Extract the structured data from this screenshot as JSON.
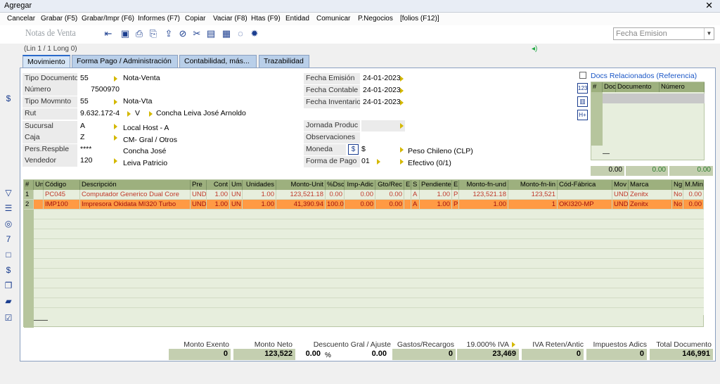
{
  "window": {
    "title": "Agregar",
    "close": "✕"
  },
  "menu": [
    "Cancelar",
    "Grabar (F5)",
    "Grabar/Impr (F6)",
    "Informes (F7)",
    "Copiar",
    "Vaciar (F8)",
    "Htas (F9)",
    "Entidad",
    "Comunicar",
    "P.Negocios",
    "[folios (F12)]"
  ],
  "toolbar": {
    "logo": "Notas de Venta",
    "sort_combo": "Fecha Emision"
  },
  "status": "(Lin 1 / 1 Long 0)",
  "tabs": [
    "Movimiento",
    "Forma Pago / Administración",
    "Contabilidad, más...",
    "Trazabilidad"
  ],
  "form": {
    "tipo_doc_label": "Tipo Documento",
    "tipo_doc": "55",
    "tipo_doc_desc": "Nota-Venta",
    "numero_label": "Número",
    "numero": "7500970",
    "tipo_mov_label": "Tipo Movmnto",
    "tipo_mov": "55",
    "tipo_mov_desc": "Nota-Vta",
    "rut_label": "Rut",
    "rut": "9.632.172-4",
    "rut_dv": "V",
    "rut_name": "Concha Leiva José Arnoldo",
    "sucursal_label": "Sucursal",
    "sucursal": "A",
    "sucursal_desc": "Local Host - A",
    "caja_label": "Caja",
    "caja": "Z",
    "caja_desc": "CM- Gral / Otros",
    "pers_label": "Pers.Respble",
    "pers": "****",
    "pers_desc": "Concha José",
    "vend_label": "Vendedor",
    "vend": "120",
    "vend_desc": "Leiva Patricio",
    "f_emision_label": "Fecha Emisión",
    "f_emision": "24-01-2023",
    "f_contable_label": "Fecha Contable",
    "f_contable": "24-01-2023",
    "f_inventario_label": "Fecha Inventario",
    "f_inventario": "24-01-2023",
    "jornada_label": "Jornada Produc",
    "obs_label": "Observaciones",
    "moneda_label": "Moneda",
    "moneda": "$",
    "moneda_desc": "Peso Chileno (CLP)",
    "forma_pago_label": "Forma de Pago",
    "forma_pago": "01",
    "forma_pago_desc": "Efectivo (0/1)"
  },
  "docs": {
    "label": "Docs Relacionados (Referencia)",
    "headers": [
      "#",
      "Doc",
      "Documento",
      "Número"
    ],
    "dash": "—",
    "sums": [
      "0.00",
      "0.00",
      "0.00"
    ]
  },
  "grid": {
    "headers": [
      "#",
      "Un",
      "Código",
      "Descripción",
      "Pre",
      "Cont",
      "Um",
      "Unidades",
      "Monto-Unit",
      "%Dsc",
      "Imp-Adic",
      "Gto/Rec",
      "E",
      "S",
      "Pendiente",
      "E.",
      "Monto-fn-und",
      "Monto-fn-lin",
      "Cód-Fábrica",
      "Mov",
      "Marca",
      "Ng",
      "M.Min"
    ],
    "rows": [
      [
        "1",
        "",
        "PC045",
        "Computador Generico Dual Core",
        "UND",
        "1.00",
        "UN",
        "1.00",
        "123,521.18",
        "0.00",
        "0.00",
        "0.00",
        "",
        "A",
        "1.00",
        "P",
        "123,521.18",
        "123,521",
        "",
        "UND",
        "Zenitx",
        "No",
        "0.00"
      ],
      [
        "2",
        "",
        "IMP100",
        "Impresora Okidata MI320 Turbo",
        "UND",
        "1.00",
        "UN",
        "1.00",
        "41,390.94",
        "100.00",
        "0.00",
        "0.00",
        "",
        "A",
        "1.00",
        "P",
        "1.00",
        "1",
        "OKI320-MP",
        "UND",
        "Zenitx",
        "No",
        "0.00"
      ]
    ],
    "dash": "——"
  },
  "totals": [
    {
      "label": "Monto Exento",
      "value": "0"
    },
    {
      "label": "Monto Neto",
      "value": "123,522"
    },
    {
      "label": "Descuento Gral / Ajuste",
      "value": "0.00",
      "pct": "0.00",
      "pct_sign": "%"
    },
    {
      "label": "Gastos/Recargos",
      "value": "0"
    },
    {
      "label": "19.000% IVA",
      "value": "23,469"
    },
    {
      "label": "IVA Reten/Antic",
      "value": "0"
    },
    {
      "label": "Impuestos Adics",
      "value": "0"
    },
    {
      "label": "Total Documento",
      "value": "146,991"
    }
  ],
  "colors": {
    "row_selected": "#ff9a44",
    "grid_header": "#9db07e",
    "grid_body": "#e7eedd",
    "tab_active": "#d5e5f6"
  }
}
